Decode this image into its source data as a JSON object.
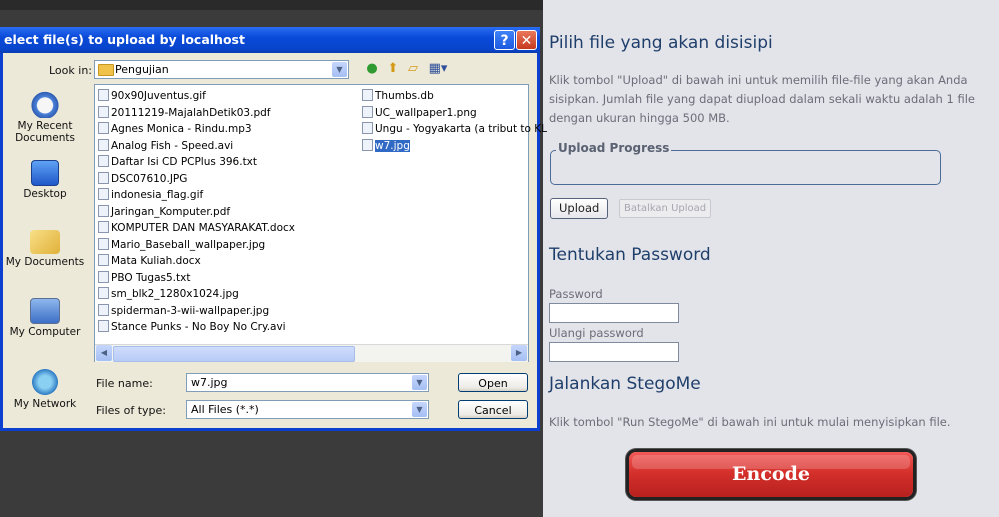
{
  "dialog": {
    "title": "elect file(s) to upload by localhost",
    "help_button": "?",
    "close_button": "✕",
    "look_in_label": "Look in:",
    "look_in_value": "Pengujian",
    "places": [
      {
        "label_line1": "My Recent",
        "label_line2": "Documents",
        "icon": "recent-documents-icon"
      },
      {
        "label_line1": "Desktop",
        "label_line2": "",
        "icon": "desktop-icon"
      },
      {
        "label_line1": "My Documents",
        "label_line2": "",
        "icon": "my-documents-icon"
      },
      {
        "label_line1": "My Computer",
        "label_line2": "",
        "icon": "my-computer-icon"
      },
      {
        "label_line1": "My Network",
        "label_line2": "",
        "icon": "my-network-icon"
      }
    ],
    "files_col1": [
      "90x90Juventus.gif",
      "20111219-MajalahDetik03.pdf",
      "Agnes Monica - Rindu.mp3",
      "Analog Fish - Speed.avi",
      "Daftar Isi CD PCPlus 396.txt",
      "DSC07610.JPG",
      "indonesia_flag.gif",
      "Jaringan_Komputer.pdf",
      "KOMPUTER DAN MASYARAKAT.docx",
      "Mario_Baseball_wallpaper.jpg",
      "Mata Kuliah.docx",
      "PBO Tugas5.txt",
      "sm_blk2_1280x1024.jpg",
      "spiderman-3-wii-wallpaper.jpg",
      "Stance Punks - No Boy No Cry.avi"
    ],
    "files_col2": [
      "Thumbs.db",
      "UC_wallpaper1.png",
      "Ungu - Yogyakarta (a tribut to KL",
      "w7.jpg"
    ],
    "selected_file": "w7.jpg",
    "file_name_label": "File name:",
    "file_name_value": "w7.jpg",
    "file_type_label": "Files of type:",
    "file_type_value": "All Files (*.*)",
    "open_button": "Open",
    "cancel_button": "Cancel"
  },
  "page": {
    "choose_title": "Pilih file yang akan disisipi",
    "choose_desc": "Klik tombol \"Upload\" di bawah ini untuk memilih file-file yang akan Anda sisipkan. Jumlah file yang dapat diupload dalam sekali waktu adalah 1 file dengan ukuran hingga 500 MB.",
    "progress_legend": "Upload Progress",
    "upload_button": "Upload",
    "cancel_upload_button": "Batalkan Upload",
    "password_title": "Tentukan Password",
    "password_label": "Password",
    "repeat_password_label": "Ulangi password",
    "run_title": "Jalankan StegoMe",
    "run_desc": "Klik tombol \"Run StegoMe\" di bawah ini untuk mulai menyisipkan file.",
    "encode_button": "Encode"
  },
  "colors": {
    "titlebar": "#0a4ad8",
    "selection": "#316ac5",
    "heading": "#1f3f6b",
    "encode": "#d5302c"
  }
}
